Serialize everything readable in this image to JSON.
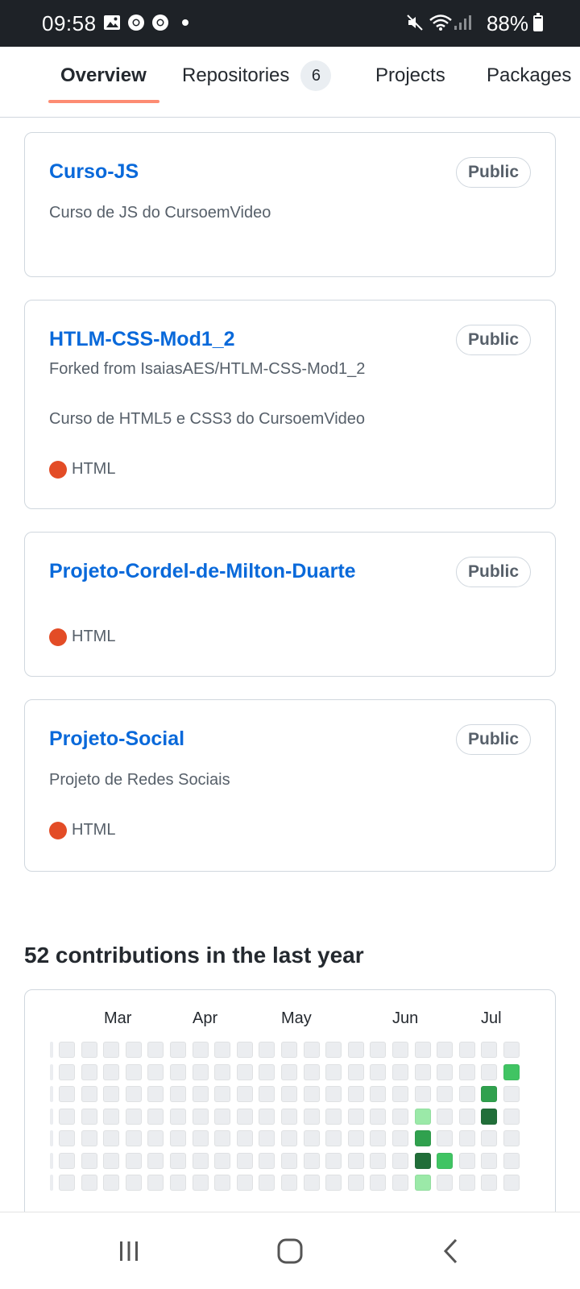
{
  "status_bar": {
    "time": "09:58",
    "battery": "88%",
    "icons": [
      "image-icon",
      "chrome-icon",
      "chrome-icon",
      "dot-icon",
      "mute-icon",
      "wifi-icon",
      "signal-icon",
      "battery-icon"
    ]
  },
  "tabs": [
    {
      "label": "Overview",
      "active": true
    },
    {
      "label": "Repositories",
      "count": "6"
    },
    {
      "label": "Projects"
    },
    {
      "label": "Packages"
    }
  ],
  "repos": [
    {
      "name": "Curso-JS",
      "visibility": "Public",
      "description": "Curso de JS do CursoemVideo"
    },
    {
      "name": "HTLM-CSS-Mod1_2",
      "visibility": "Public",
      "forked_from": "Forked from IsaiasAES/HTLM-CSS-Mod1_2",
      "description": "Curso de HTML5 e CSS3 do CursoemVideo",
      "language": "HTML"
    },
    {
      "name": "Projeto-Cordel-de-Milton-Duarte",
      "visibility": "Public",
      "language": "HTML"
    },
    {
      "name": "Projeto-Social",
      "visibility": "Public",
      "description": "Projeto de Redes Sociais",
      "language": "HTML"
    }
  ],
  "contributions": {
    "title": "52 contributions in the last year",
    "months": [
      "Mar",
      "Apr",
      "May",
      "Jun",
      "Jul"
    ],
    "grid_columns": 21,
    "active_cells": [
      {
        "week": 16,
        "day": 3,
        "level": 1
      },
      {
        "week": 16,
        "day": 4,
        "level": 3
      },
      {
        "week": 16,
        "day": 5,
        "level": 4
      },
      {
        "week": 16,
        "day": 6,
        "level": 1
      },
      {
        "week": 17,
        "day": 5,
        "level": 2
      },
      {
        "week": 19,
        "day": 2,
        "level": 3
      },
      {
        "week": 19,
        "day": 3,
        "level": 4
      },
      {
        "week": 20,
        "day": 1,
        "level": 2
      }
    ],
    "colors": {
      "level0": "#ebedf0",
      "level1": "#9be9a8",
      "level2": "#40c463",
      "level3": "#30a14e",
      "level4": "#216e39"
    }
  },
  "colors": {
    "link": "#0969da",
    "html_language": "#e34c26",
    "tab_accent": "#fd8c73"
  },
  "nav_bar": {
    "buttons": [
      "recent-apps",
      "home",
      "back"
    ]
  }
}
